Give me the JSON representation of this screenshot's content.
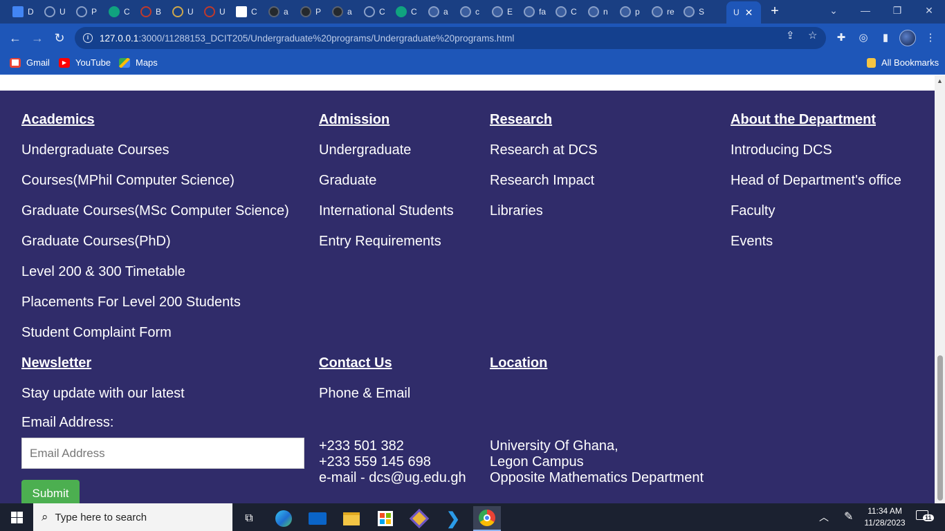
{
  "browser": {
    "tabs": [
      {
        "label": "D",
        "icon": "docs-icon",
        "color": "#4285f4"
      },
      {
        "label": "U",
        "icon": "loading-icon",
        "color": "#8aa0c8"
      },
      {
        "label": "P",
        "icon": "loading-icon",
        "color": "#8aa0c8"
      },
      {
        "label": "C",
        "icon": "chatgpt-icon",
        "color": "#10a37f"
      },
      {
        "label": "B",
        "icon": "ug-crest-icon",
        "color": "#c0392b"
      },
      {
        "label": "U",
        "icon": "compass-icon",
        "color": "#cfa84b"
      },
      {
        "label": "U",
        "icon": "ug-crest-icon",
        "color": "#c0392b"
      },
      {
        "label": "C",
        "icon": "ug-logo-icon",
        "color": "#ffffff"
      },
      {
        "label": "a",
        "icon": "github-icon",
        "color": "#24292e"
      },
      {
        "label": "P",
        "icon": "github-icon",
        "color": "#24292e"
      },
      {
        "label": "a",
        "icon": "github-icon",
        "color": "#24292e"
      },
      {
        "label": "C",
        "icon": "gear-icon",
        "color": "#8aa0c8"
      },
      {
        "label": "C",
        "icon": "chatgpt-icon",
        "color": "#10a37f"
      },
      {
        "label": "a",
        "icon": "globe-icon",
        "color": "#8aa0c8"
      },
      {
        "label": "c",
        "icon": "globe-icon",
        "color": "#8aa0c8"
      },
      {
        "label": "E",
        "icon": "globe-icon",
        "color": "#8aa0c8"
      },
      {
        "label": "fa",
        "icon": "globe-icon",
        "color": "#8aa0c8"
      },
      {
        "label": "C",
        "icon": "globe-icon",
        "color": "#8aa0c8"
      },
      {
        "label": "n",
        "icon": "globe-icon",
        "color": "#8aa0c8"
      },
      {
        "label": "p",
        "icon": "globe-icon",
        "color": "#8aa0c8"
      },
      {
        "label": "re",
        "icon": "globe-icon",
        "color": "#8aa0c8"
      },
      {
        "label": "S",
        "icon": "globe-icon",
        "color": "#8aa0c8"
      }
    ],
    "active_tab": {
      "label": "U"
    },
    "url_host": "127.0.0.1",
    "url_rest": ":3000/11288153_DCIT205/Undergraduate%20programs/Undergraduate%20programs.html",
    "bookmarks": [
      {
        "label": "Gmail",
        "icon": "gmail-icon"
      },
      {
        "label": "YouTube",
        "icon": "youtube-icon"
      },
      {
        "label": "Maps",
        "icon": "maps-icon"
      }
    ],
    "all_bookmarks": "All Bookmarks"
  },
  "footer": {
    "academics": {
      "heading": "Academics",
      "links": [
        "Undergraduate Courses",
        "Courses(MPhil Computer Science)",
        "Graduate Courses(MSc Computer Science)",
        "Graduate Courses(PhD)",
        "Level 200 & 300 Timetable",
        "Placements For Level 200 Students",
        "Student Complaint Form"
      ]
    },
    "admission": {
      "heading": "Admission",
      "links": [
        "Undergraduate",
        "Graduate",
        "International Students",
        "Entry Requirements"
      ]
    },
    "research": {
      "heading": "Research",
      "links": [
        "Research at DCS",
        "Research Impact",
        "Libraries"
      ]
    },
    "about": {
      "heading": "About the Department",
      "links": [
        "Introducing DCS",
        "Head of Department's office",
        "Faculty",
        "Events"
      ]
    },
    "newsletter": {
      "heading": "Newsletter",
      "text": "Stay update with our latest",
      "email_label": "Email Address:",
      "email_placeholder": "Email Address",
      "submit": "Submit"
    },
    "contact": {
      "heading": "Contact Us",
      "subheading": "Phone & Email",
      "lines": [
        "+233 501 382",
        "+233 559 145 698",
        "e-mail - dcs@ug.edu.gh"
      ]
    },
    "location": {
      "heading": "Location",
      "lines": [
        "University Of Ghana,",
        "Legon Campus",
        "Opposite Mathematics Department"
      ]
    }
  },
  "taskbar": {
    "search_placeholder": "Type here to search",
    "time": "11:34 AM",
    "date": "11/28/2023",
    "notifications": "11"
  }
}
